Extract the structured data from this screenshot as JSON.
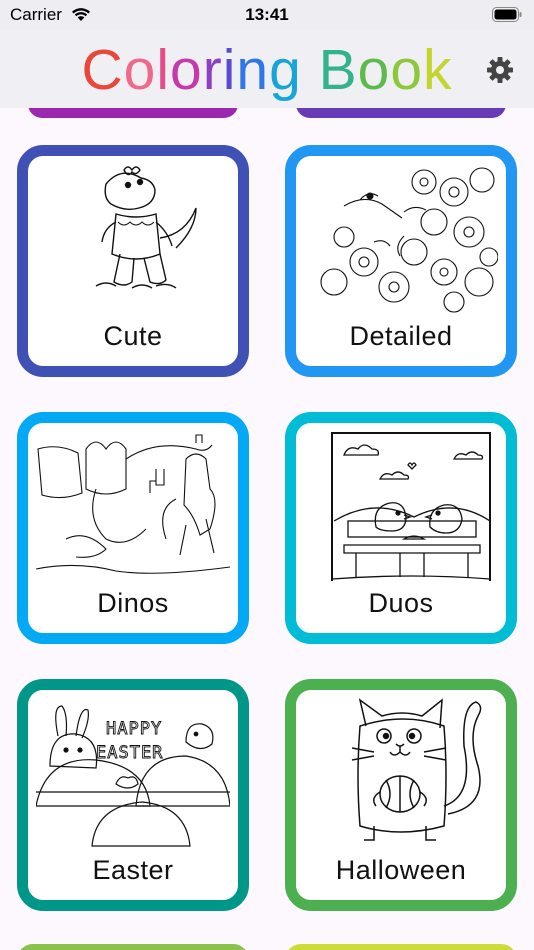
{
  "status": {
    "carrier": "Carrier",
    "time": "13:41"
  },
  "header": {
    "title_letters": [
      {
        "ch": "C",
        "color": "#e8473a"
      },
      {
        "ch": "o",
        "color": "#ef6a8a"
      },
      {
        "ch": "l",
        "color": "#e44d8d"
      },
      {
        "ch": "o",
        "color": "#c639a8"
      },
      {
        "ch": "r",
        "color": "#8f3fc1"
      },
      {
        "ch": "i",
        "color": "#5a4ccc"
      },
      {
        "ch": "n",
        "color": "#2f77e6"
      },
      {
        "ch": "g",
        "color": "#17a5d8"
      },
      {
        "ch": " ",
        "color": "#000"
      },
      {
        "ch": "B",
        "color": "#33b38a"
      },
      {
        "ch": "o",
        "color": "#5cbb4b"
      },
      {
        "ch": "o",
        "color": "#8cc83a"
      },
      {
        "ch": "k",
        "color": "#c3d62c"
      }
    ],
    "settings_icon": "gear-icon"
  },
  "categories": [
    {
      "label": "Cute",
      "color": "#3f51b5",
      "art": "dragon-art"
    },
    {
      "label": "Detailed",
      "color": "#2196f3",
      "art": "flowers-bird-art"
    },
    {
      "label": "Dinos",
      "color": "#03a9f4",
      "art": "dragon-knight-art"
    },
    {
      "label": "Duos",
      "color": "#00bcd4",
      "art": "birds-bench-art"
    },
    {
      "label": "Easter",
      "color": "#009688",
      "art": "easter-art"
    },
    {
      "label": "Halloween",
      "color": "#4caf50",
      "art": "cat-art"
    }
  ],
  "peek_colors": {
    "top_left": "#9c27b0",
    "top_right": "#673ab7",
    "bottom_left": "#8bc34a",
    "bottom_right": "#cddc39"
  }
}
